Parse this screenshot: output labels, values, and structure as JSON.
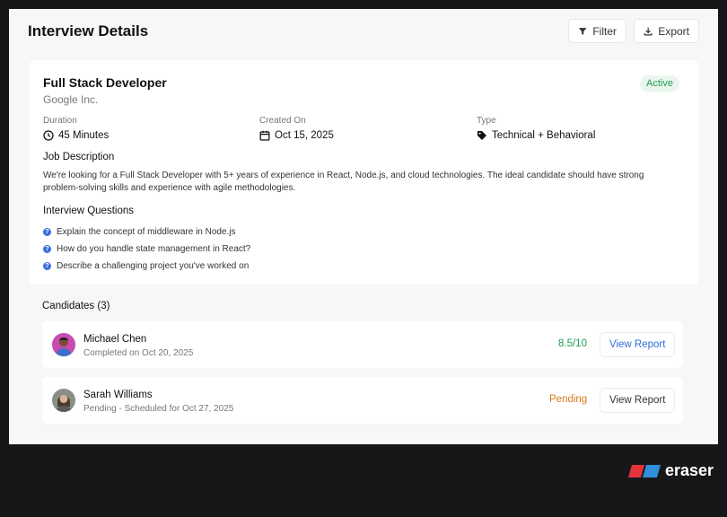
{
  "header": {
    "title": "Interview Details",
    "filter_label": "Filter",
    "export_label": "Export"
  },
  "job": {
    "title": "Full Stack Developer",
    "company": "Google Inc.",
    "status": "Active",
    "duration": {
      "label": "Duration",
      "value": "45 Minutes"
    },
    "created": {
      "label": "Created On",
      "value": "Oct 15, 2025"
    },
    "type": {
      "label": "Type",
      "value": "Technical + Behavioral"
    },
    "description_title": "Job Description",
    "description": "We're looking for a Full Stack Developer with 5+ years of experience in React, Node.js, and cloud technologies. The ideal candidate should have strong problem-solving skills and experience with agile methodologies.",
    "questions_title": "Interview Questions",
    "questions": [
      "Explain the concept of middleware in Node.js",
      "How do you handle state management in React?",
      "Describe a challenging project you've worked on"
    ]
  },
  "candidates": {
    "title": "Candidates (3)",
    "rows": [
      {
        "name": "Michael Chen",
        "subtitle": "Completed on Oct 20, 2025",
        "score": "8.5/10",
        "action": "View Report"
      },
      {
        "name": "Sarah Williams",
        "subtitle": "Pending - Scheduled for Oct 27, 2025",
        "score": "Pending",
        "action": "View Report"
      }
    ]
  },
  "colors": {
    "active": "#1f9d55",
    "pending": "#d97a1e",
    "link": "#2f6fd6",
    "accent_blue": "#3b6fe0"
  },
  "brand": {
    "name": "eraser"
  }
}
